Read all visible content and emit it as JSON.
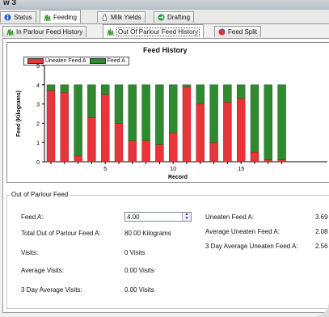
{
  "window": {
    "title": "w 3"
  },
  "main_tabs": [
    {
      "label": "Status",
      "active": false
    },
    {
      "label": "Feeding",
      "active": true
    },
    {
      "label": "Milk Yields",
      "active": false
    },
    {
      "label": "Drafting",
      "active": false
    }
  ],
  "sub_tabs": [
    {
      "label": "In Parlour Feed History",
      "active": false
    },
    {
      "label": "Out Of Parlour Feed History",
      "active": true
    },
    {
      "label": "Feed Split",
      "active": false
    }
  ],
  "colors": {
    "uneaten": "#e8343a",
    "feed": "#2f8a2f"
  },
  "chart_data": {
    "type": "bar",
    "stacked": true,
    "title": "Feed History",
    "xlabel": "Record",
    "ylabel": "Feed (Kilograms)",
    "ylim": [
      0,
      5
    ],
    "yticks": [
      0,
      1,
      2,
      3,
      4,
      5
    ],
    "xticks": [
      5,
      10,
      15
    ],
    "x": [
      1,
      2,
      3,
      4,
      5,
      6,
      7,
      8,
      9,
      10,
      11,
      12,
      13,
      14,
      15,
      16,
      17,
      18
    ],
    "series": [
      {
        "name": "Uneaten Feed A",
        "values": [
          3.7,
          3.6,
          0.3,
          2.3,
          3.5,
          2.0,
          1.1,
          1.1,
          0.9,
          1.5,
          3.9,
          3.0,
          1.0,
          3.1,
          3.3,
          0.5,
          0.1,
          0.1
        ]
      },
      {
        "name": "Feed A",
        "values": [
          0.3,
          0.4,
          3.7,
          1.7,
          0.5,
          2.0,
          2.9,
          2.9,
          3.1,
          2.5,
          0.1,
          1.0,
          3.0,
          0.9,
          0.7,
          3.5,
          3.9,
          3.9
        ]
      }
    ],
    "grid": false,
    "legend": "top-left"
  },
  "form": {
    "group_title": "Out of Parlour Feed",
    "feed_a_label": "Feed A:",
    "feed_a_value": "4.00",
    "total_label": "Total Out of Parlour Feed A:",
    "total_value": "80.00 Kilograms",
    "visits_label": "Visits:",
    "visits_value": "0 Visits",
    "avg_visits_label": "Average Visits:",
    "avg_visits_value": "0.00 Visits",
    "three_day_visits_label": "3 Day Average Visits:",
    "three_day_visits_value": "0.00 Visits",
    "uneaten_label": "Uneaten Feed A:",
    "uneaten_value": "3.69",
    "avg_uneaten_label": "Average Uneaten Feed A:",
    "avg_uneaten_value": "2.08",
    "three_day_uneaten_label": "3 Day Average Uneaten Feed A:",
    "three_day_uneaten_value": "2.56"
  }
}
